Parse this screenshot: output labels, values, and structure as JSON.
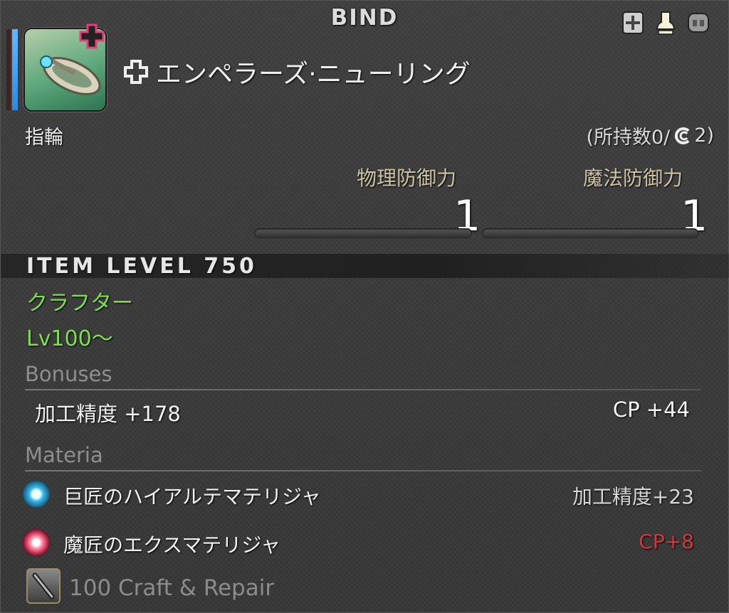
{
  "header": {
    "title": "BIND"
  },
  "item": {
    "name": "エンペラーズ·ニューリング",
    "type": "指輪",
    "count": {
      "prefix": "(所持数0/",
      "suffix": "2)"
    }
  },
  "stats": [
    {
      "label": "物理防御力",
      "value": "1"
    },
    {
      "label": "魔法防御力",
      "value": "1"
    }
  ],
  "item_level": "ITEM LEVEL 750",
  "classes": "クラフター",
  "level": "Lv100～",
  "bonuses": {
    "title": "Bonuses",
    "items": [
      {
        "label": "加工精度 +178"
      },
      {
        "label": "CP +44"
      }
    ]
  },
  "materia": {
    "title": "Materia",
    "items": [
      {
        "name": "巨匠のハイアルテマテリジャ",
        "value": "加工精度+23",
        "color": "#3ab8e8"
      },
      {
        "name": "魔匠のエクスマテリジャ",
        "value": "CP+8",
        "color": "#e84a6a",
        "value_color": "#d23a3a"
      }
    ]
  },
  "repair": {
    "text": "100 Craft & Repair"
  },
  "colors": {
    "green_text": "#7fe04c",
    "stat_label": "#cfc4a4",
    "accent_pink": "#e0407a"
  }
}
